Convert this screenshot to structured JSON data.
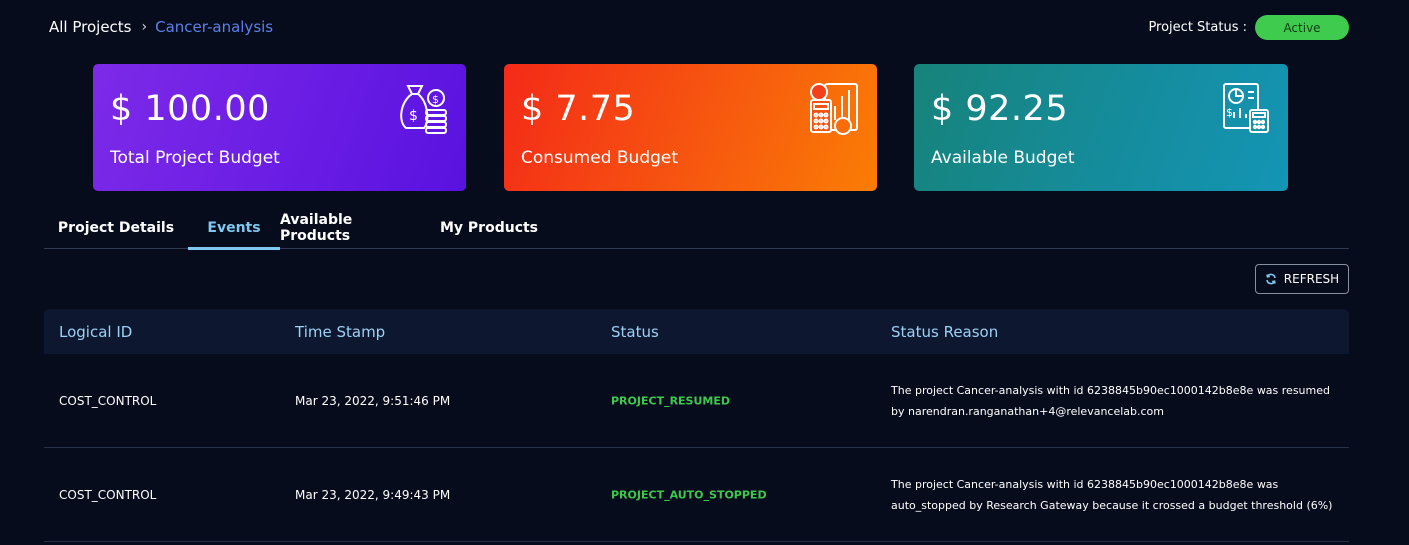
{
  "breadcrumb": {
    "root": "All Projects",
    "separator": "›",
    "current": "Cancer-analysis"
  },
  "project_status": {
    "label": "Project Status :",
    "value": "Active",
    "color": "#3fcc4e"
  },
  "cards": [
    {
      "value": "$ 100.00",
      "label": "Total Project Budget",
      "icon": "money-bag-coins-icon"
    },
    {
      "value": "$ 7.75",
      "label": "Consumed Budget",
      "icon": "calculator-chart-icon"
    },
    {
      "value": "$ 92.25",
      "label": "Available Budget",
      "icon": "report-calculator-icon"
    }
  ],
  "tabs": [
    {
      "label": "Project Details",
      "active": false
    },
    {
      "label": "Events",
      "active": true
    },
    {
      "label": "Available Products",
      "active": false
    },
    {
      "label": "My Products",
      "active": false
    }
  ],
  "refresh": {
    "label": "REFRESH",
    "icon": "refresh-icon"
  },
  "table": {
    "columns": [
      "Logical ID",
      "Time Stamp",
      "Status",
      "Status Reason"
    ],
    "rows": [
      {
        "logical_id": "COST_CONTROL",
        "timestamp": "Mar 23, 2022, 9:51:46 PM",
        "status": "PROJECT_RESUMED",
        "reason": "The project Cancer-analysis with id 6238845b90ec1000142b8e8e was resumed by narendran.ranganathan+4@relevancelab.com"
      },
      {
        "logical_id": "COST_CONTROL",
        "timestamp": "Mar 23, 2022, 9:49:43 PM",
        "status": "PROJECT_AUTO_STOPPED",
        "reason": "The project Cancer-analysis with id 6238845b90ec1000142b8e8e was auto_stopped by Research Gateway because it crossed a budget threshold (6%)"
      }
    ]
  },
  "colors": {
    "background": "#070c1c",
    "accent": "#7fc8f0",
    "status_green": "#3cc84c"
  }
}
